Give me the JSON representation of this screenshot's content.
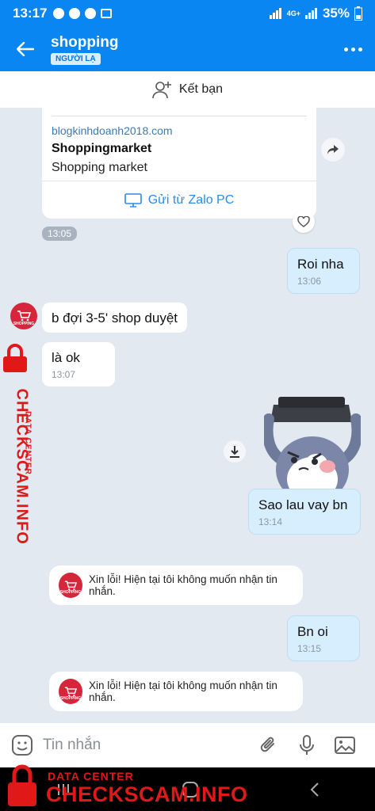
{
  "status_bar": {
    "time": "13:17",
    "signal_label": "4G+",
    "battery": "35%"
  },
  "header": {
    "title": "shopping",
    "badge": "NGƯỜI LẠ"
  },
  "add_friend": {
    "label": "Kết bạn"
  },
  "link_card": {
    "domain": "blogkinhdoanh2018.com",
    "name": "Shoppingmarket",
    "description": "Shopping market",
    "sent_from": "Gửi từ Zalo PC",
    "time": "13:05"
  },
  "messages": [
    {
      "direction": "out",
      "text": "Roi nha",
      "time": "13:06"
    },
    {
      "direction": "in",
      "text": "b đợi 3-5' shop duyệt"
    },
    {
      "direction": "in",
      "text": "là ok",
      "time": "13:07"
    },
    {
      "direction": "out",
      "text": "Sao lau vay bn",
      "time": "13:14"
    },
    {
      "direction": "out",
      "text": "Bn oi",
      "time": "13:15"
    }
  ],
  "system_notes": [
    {
      "text": "Xin lỗi! Hiện tại tôi không muốn nhận tin nhắn."
    },
    {
      "text": "Xin lỗi! Hiện tại tôi không muốn nhận tin nhắn."
    }
  ],
  "avatar_label": "SHOPPING",
  "input": {
    "placeholder": "Tin nhắn"
  },
  "watermark": {
    "small": "DATA CENTER",
    "big": "CHECKSCAM.INFO"
  },
  "colors": {
    "accent": "#0a86f2",
    "out_bubble": "#d7eefe",
    "watermark": "#e01818"
  }
}
